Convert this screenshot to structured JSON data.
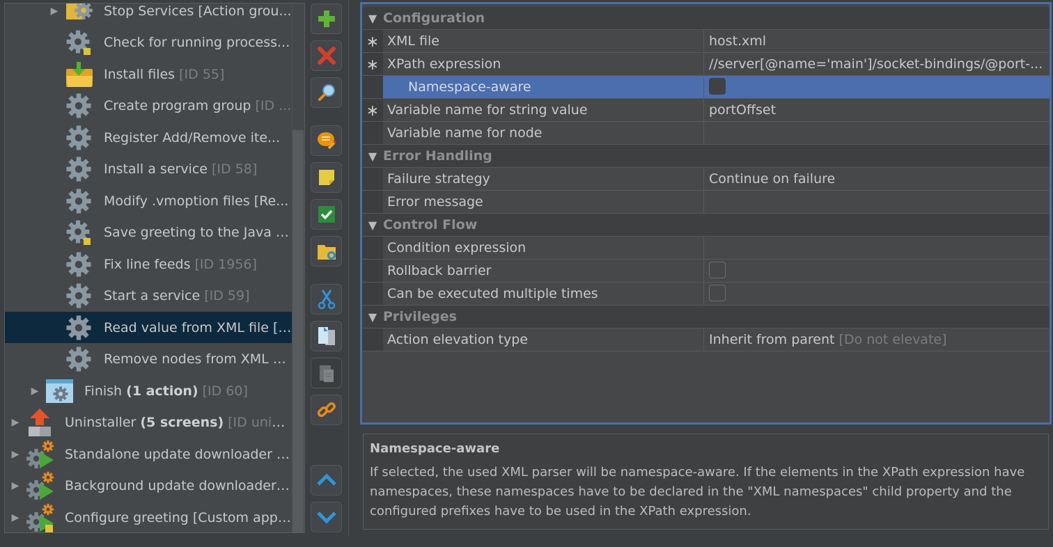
{
  "tree": {
    "items": [
      {
        "label": "Stop Services [Action grou...",
        "meta": "",
        "icon": "action-group-gear-icon",
        "expandable": true,
        "level": 2
      },
      {
        "label": "Check for running process...",
        "meta": "",
        "icon": "gear-note-icon",
        "expandable": false,
        "level": 2
      },
      {
        "label": "Install files",
        "meta": "[ID 55]",
        "icon": "install-folder-icon",
        "expandable": false,
        "level": 2
      },
      {
        "label": "Create program group",
        "meta": "[ID ...",
        "icon": "gear-icon",
        "expandable": false,
        "level": 2
      },
      {
        "label": "Register Add/Remove ite...",
        "meta": "",
        "icon": "gear-icon",
        "expandable": false,
        "level": 2
      },
      {
        "label": "Install a service",
        "meta": "[ID 58]",
        "icon": "gear-icon",
        "expandable": false,
        "level": 2
      },
      {
        "label": "Modify .vmoption files [Re...",
        "meta": "",
        "icon": "gear-icon",
        "expandable": false,
        "level": 2
      },
      {
        "label": "Save greeting to the Java p...",
        "meta": "",
        "icon": "gear-note-icon",
        "expandable": false,
        "level": 2
      },
      {
        "label": "Fix line feeds",
        "meta": "[ID 1956]",
        "icon": "gear-icon",
        "expandable": false,
        "level": 2
      },
      {
        "label": "Start a service",
        "meta": "[ID 59]",
        "icon": "gear-icon",
        "expandable": false,
        "level": 2
      },
      {
        "label": "Read value from XML file [I...",
        "meta": "",
        "icon": "gear-icon",
        "expandable": false,
        "level": 2,
        "selected": true
      },
      {
        "label": "Remove nodes from XML fi...",
        "meta": "",
        "icon": "gear-icon",
        "expandable": false,
        "level": 2
      },
      {
        "label": "Finish",
        "bold": "(1 action)",
        "meta": "[ID 60]",
        "icon": "screen-gear-icon",
        "expandable": true,
        "level": 1
      },
      {
        "label": "Uninstaller",
        "bold": "(5 screens)",
        "meta": "[ID uninst...",
        "icon": "uninstaller-icon",
        "expandable": true,
        "level": 0
      },
      {
        "label": "Standalone update downloader [...",
        "meta": "",
        "icon": "application-launcher-icon",
        "expandable": true,
        "level": 0
      },
      {
        "label": "Background update downloader [...",
        "meta": "",
        "icon": "application-launcher-icon",
        "expandable": true,
        "level": 0
      },
      {
        "label": "Configure greeting [Custom appli...",
        "meta": "",
        "icon": "application-launcher-note-icon",
        "expandable": true,
        "level": 0
      }
    ]
  },
  "toolbar": {
    "buttons": [
      {
        "name": "add-button",
        "icon": "plus-icon"
      },
      {
        "name": "delete-button",
        "icon": "x-icon"
      },
      {
        "name": "search-button",
        "icon": "magnifier-icon"
      },
      {
        "name": "comment-button",
        "icon": "comment-icon"
      },
      {
        "name": "note-button",
        "icon": "sticky-note-icon"
      },
      {
        "name": "check-button",
        "icon": "check-icon"
      },
      {
        "name": "folder-button",
        "icon": "folder-link-icon"
      },
      {
        "name": "cut-button",
        "icon": "scissors-icon"
      },
      {
        "name": "copy-button",
        "icon": "copy-icon"
      },
      {
        "name": "paste-button",
        "icon": "paste-icon"
      },
      {
        "name": "link-button",
        "icon": "chain-link-icon"
      },
      {
        "name": "move-up-button",
        "icon": "chevron-up-icon"
      },
      {
        "name": "move-down-button",
        "icon": "chevron-down-icon"
      }
    ]
  },
  "properties": {
    "categories": [
      {
        "title": "Configuration",
        "rows": [
          {
            "name": "XML file",
            "value": "host.xml",
            "required": true
          },
          {
            "name": "XPath expression",
            "value": "//server[@name='main']/socket-bindings/@port-...",
            "required": true
          },
          {
            "name": "Namespace-aware",
            "checkbox": true,
            "checked": false,
            "indent": true,
            "selected": true
          },
          {
            "name": "Variable name for string value",
            "value": "portOffset",
            "required": true
          },
          {
            "name": "Variable name for node",
            "value": ""
          }
        ]
      },
      {
        "title": "Error Handling",
        "rows": [
          {
            "name": "Failure strategy",
            "value": "Continue on failure"
          },
          {
            "name": "Error message",
            "value": ""
          }
        ]
      },
      {
        "title": "Control Flow",
        "rows": [
          {
            "name": "Condition expression",
            "value": ""
          },
          {
            "name": "Rollback barrier",
            "checkbox": true,
            "checked": false
          },
          {
            "name": "Can be executed multiple times",
            "checkbox": true,
            "checked": false
          }
        ]
      },
      {
        "title": "Privileges",
        "rows": [
          {
            "name": "Action elevation type",
            "value": "Inherit from parent",
            "hint": "[Do not elevate]"
          }
        ]
      }
    ]
  },
  "description": {
    "title": "Namespace-aware",
    "text": "If selected, the used XML parser will be namespace-aware. If the elements in the XPath expression have namespaces, these namespaces have to be declared in the \"XML namespaces\" child property and the configured prefixes have to be used in the XPath expression."
  },
  "colors": {
    "selection_tree": "#0d293e",
    "selection_props": "#4b6eaf",
    "focus_border": "#4a6fa5"
  }
}
